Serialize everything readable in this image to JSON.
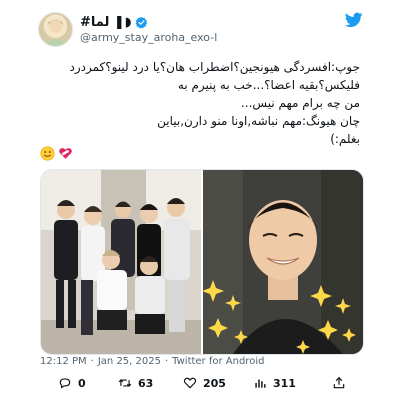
{
  "author": {
    "display_name": "#لما ❚◗",
    "handle": "@army_stay_aroha_exo-l",
    "verified": true
  },
  "tweet": {
    "lines": [
      "جوپ:افسردگی هیونجین؟اضطراب هان؟یا درد لینو؟کمردرد",
      "فلیکس؟بقیه اعضا؟...خب به پنیرم به",
      "من چه برام مهم نیس...",
      "چان هیونگ:مهم نباشه,اونا منو دارن,بیاین",
      "بغلم:)"
    ],
    "emojis": [
      "slightly-smiling-face",
      "mending-heart"
    ]
  },
  "meta": {
    "time": "12:12 PM",
    "separator1": "·",
    "date": "Jan 25, 2025",
    "separator2": "·",
    "source": "Twitter for Android"
  },
  "actions": {
    "reply_count": "0",
    "retweet_count": "63",
    "like_count": "205",
    "views_count": "311"
  },
  "colors": {
    "twitter_blue": "#1d9bf0",
    "text_primary": "#0f1419",
    "text_secondary": "#536471"
  }
}
